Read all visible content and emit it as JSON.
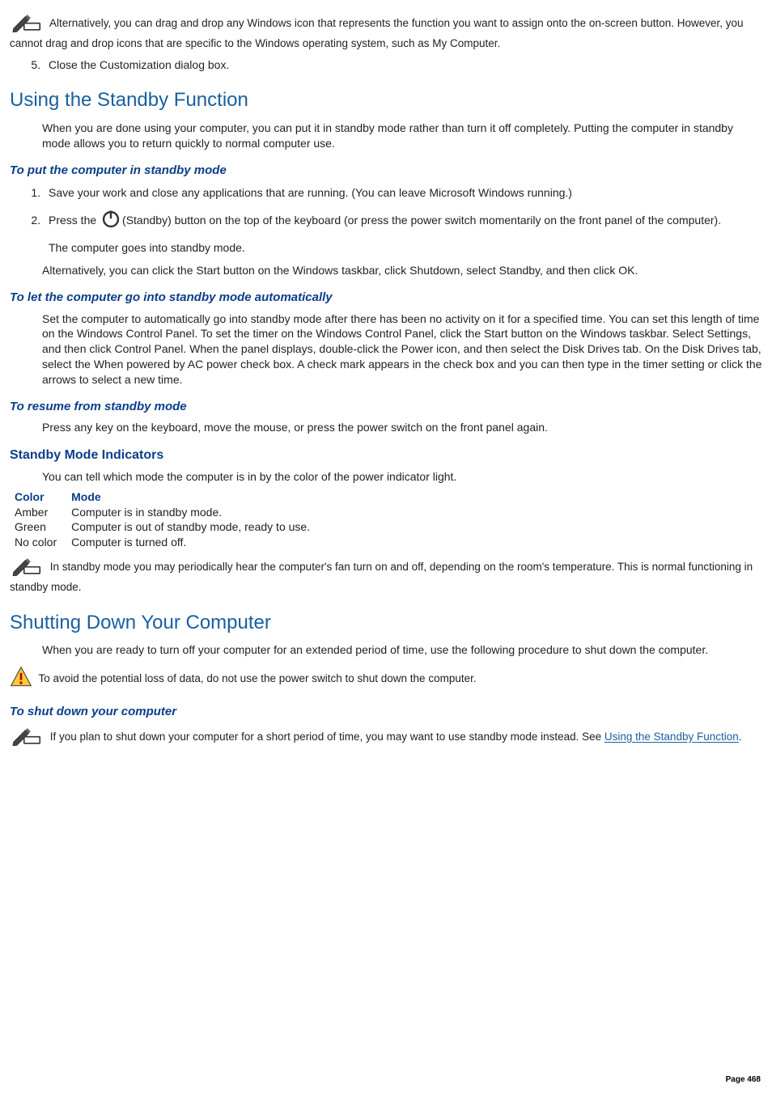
{
  "note1": "Alternatively, you can drag and drop any Windows icon that represents the function you want to assign onto the on-screen button. However, you cannot drag and drop icons that are specific to the Windows operating system, such as My Computer.",
  "step5": "Close the Customization dialog box.",
  "h_standby": "Using the Standby Function",
  "standby_intro": "When you are done using your computer, you can put it in standby mode rather than turn it off completely. Putting the computer in standby mode allows you to return quickly to normal computer use.",
  "h_put_standby": "To put the computer in standby mode",
  "put_step1": "Save your work and close any applications that are running. (You can leave Microsoft Windows running.)",
  "put_step2_pre": "Press the ",
  "put_step2_post": "(Standby) button on the top of the keyboard (or press the power switch momentarily on the front panel of the computer).",
  "put_step2_result": "The computer goes into standby mode.",
  "put_alt": "Alternatively, you can click the Start button on the Windows taskbar, click Shutdown, select Standby, and then click OK.",
  "h_auto_standby": "To let the computer go into standby mode automatically",
  "auto_standby_body": "Set the computer to automatically go into standby mode after there has been no activity on it for a specified time. You can set this length of time on the Windows Control Panel. To set the timer on the Windows Control Panel, click the Start button on the Windows taskbar. Select Settings, and then click Control Panel. When the panel displays, double-click the Power icon, and then select the Disk Drives tab. On the Disk Drives tab, select the When powered by AC power check box. A check mark appears in the check box and you can then type in the timer setting or click the arrows to select a new time.",
  "h_resume": "To resume from standby mode",
  "resume_body": "Press any key on the keyboard, move the mouse, or press the power switch on the front panel again.",
  "h_indicators": "Standby Mode Indicators",
  "indicators_intro": "You can tell which mode the computer is in by the color of the power indicator light.",
  "table": {
    "col1": "Color",
    "col2": "Mode",
    "rows": [
      {
        "c": "Amber",
        "m": "Computer is in standby mode."
      },
      {
        "c": "Green",
        "m": "Computer is out of standby mode, ready to use."
      },
      {
        "c": "No color",
        "m": "Computer is turned off."
      }
    ]
  },
  "note_fan": "In standby mode you may periodically hear the computer's fan turn on and off, depending on the room's temperature. This is normal functioning in standby mode.",
  "h_shutdown": "Shutting Down Your Computer",
  "shutdown_intro": "When you are ready to turn off your computer for an extended period of time, use the following procedure to shut down the computer.",
  "warn_shutdown": "To avoid the potential loss of data, do not use the power switch to shut down the computer.",
  "h_shutdown_proc": "To shut down your computer",
  "note_short_shutdown_pre": "If you plan to shut down your computer for a short period of time, you may want to use standby mode instead. See ",
  "note_short_shutdown_link": "Using the Standby Function",
  "note_short_shutdown_post": ".",
  "page_number": "Page 468"
}
